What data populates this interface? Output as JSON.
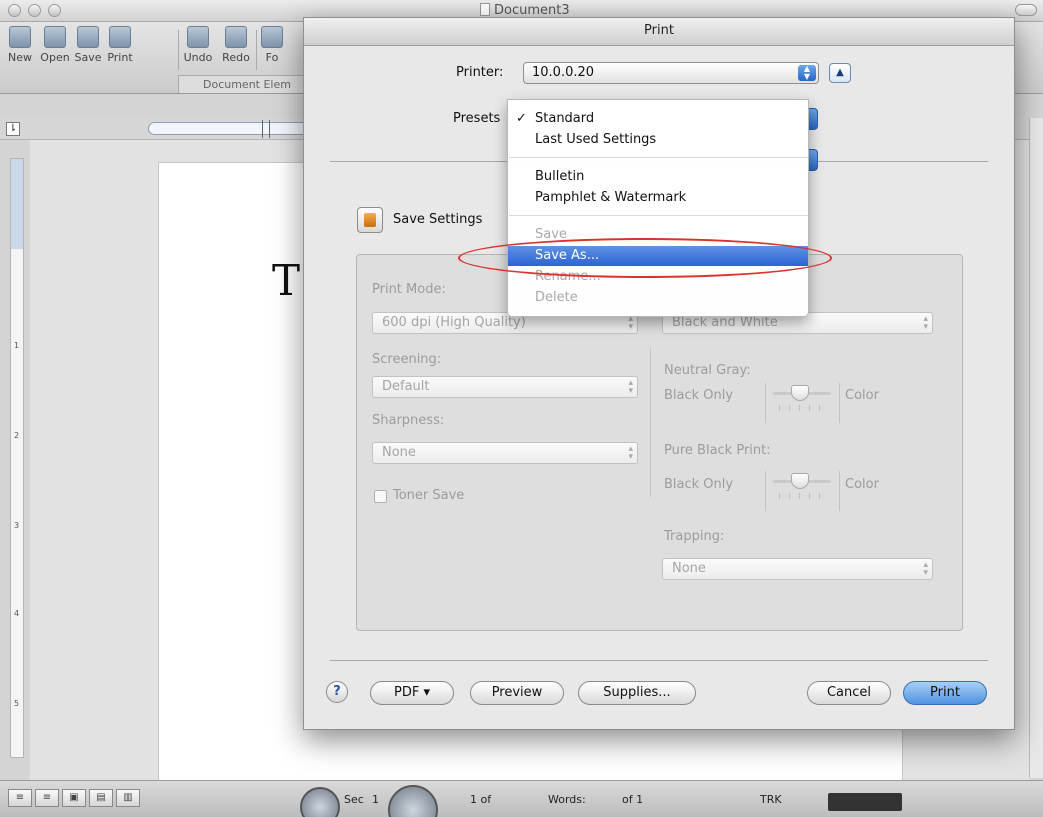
{
  "word": {
    "title": "Document3",
    "toolbar": [
      "New",
      "Open",
      "Save",
      "Print",
      "Undo",
      "Redo",
      "Fo"
    ],
    "gallery_tab": "Document Elem",
    "doc_text": "T",
    "status": {
      "sec": "Sec",
      "sec_value": "1",
      "pages": "1 of",
      "words": "Words:",
      "of": "of 1",
      "trk": "TRK"
    }
  },
  "print": {
    "title": "Print",
    "printer_label": "Printer:",
    "printer_value": "10.0.0.20",
    "presets_label": "Presets",
    "save_settings_label": "Save Settings",
    "print_mode_label": "Print Mode:",
    "print_mode_value": "600 dpi (High Quality)",
    "color_mode_value": "Black and White",
    "screening_label": "Screening:",
    "screening_value": "Default",
    "sharpness_label": "Sharpness:",
    "sharpness_value": "None",
    "toner_save_label": "Toner Save",
    "neutral_gray_label": "Neutral Gray:",
    "neutral_gray_left": "Black Only",
    "neutral_gray_right": "Color",
    "pure_black_label": "Pure Black Print:",
    "pure_black_left": "Black Only",
    "pure_black_right": "Color",
    "trapping_label": "Trapping:",
    "trapping_value": "None",
    "help": "?",
    "pdf_button": "PDF ▾",
    "preview_button": "Preview",
    "supplies_button": "Supplies...",
    "cancel_button": "Cancel",
    "print_button": "Print"
  },
  "presets_menu": {
    "standard_check": "✓",
    "items": [
      "Standard",
      "Last Used Settings",
      "Bulletin",
      "Pamphlet & Watermark",
      "Save",
      "Save As...",
      "Rename...",
      "Delete"
    ],
    "highlighted": "Save As..."
  },
  "colors": {
    "highlight": "#3a70d8",
    "annotation": "#d9322f",
    "default_button": "#4f93e0"
  }
}
